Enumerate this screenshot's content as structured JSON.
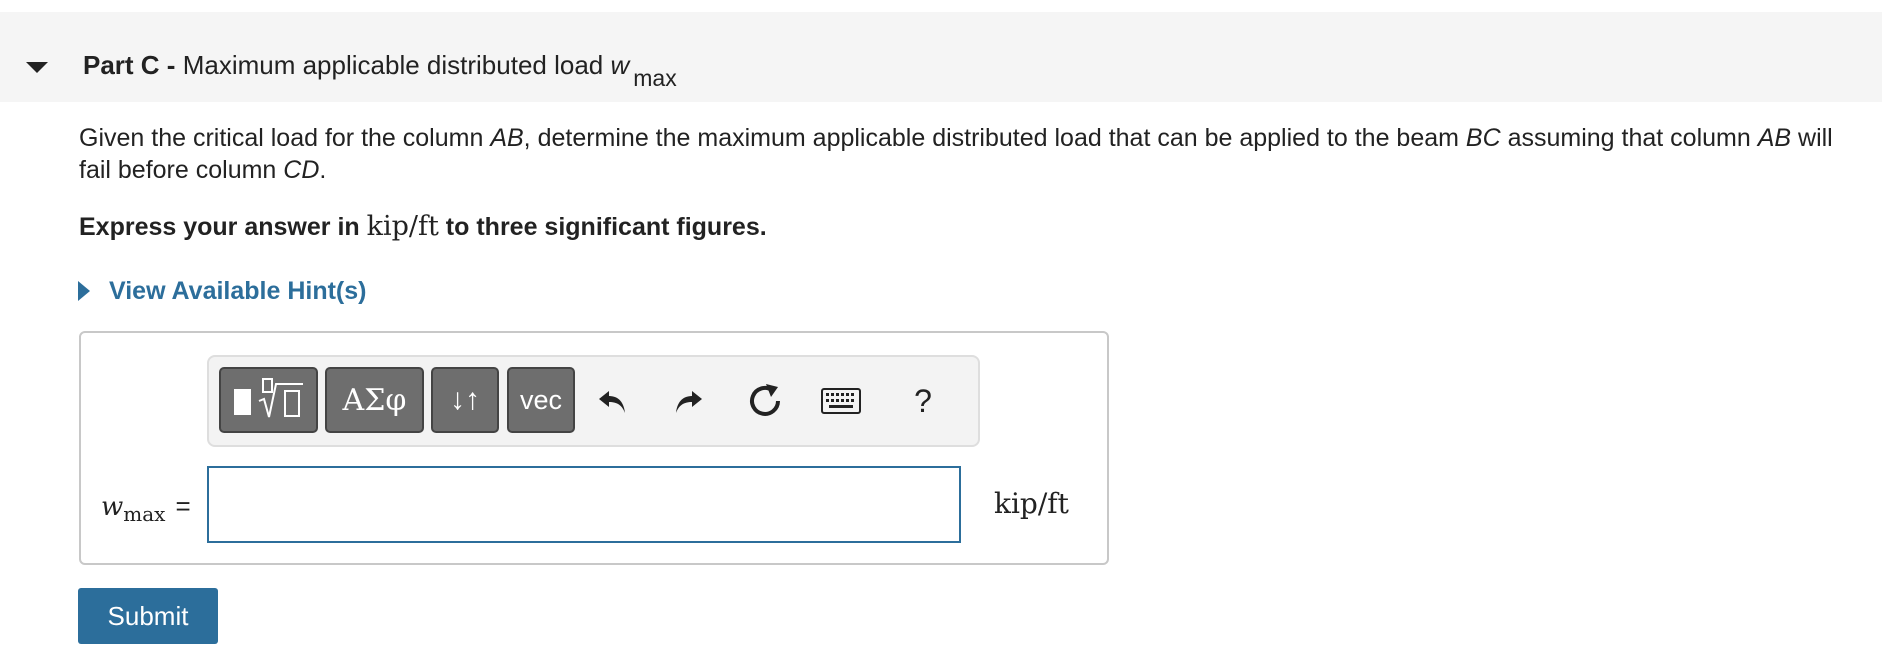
{
  "part": {
    "label": "Part C -",
    "title": "Maximum applicable distributed load",
    "var": "w",
    "sub": "max"
  },
  "question": {
    "t1": "Given the critical load for the column ",
    "AB": "AB",
    "t2": ", determine the maximum applicable distributed load that can be applied to the beam ",
    "BC": "BC",
    "t3": " assuming that column ",
    "AB2": "AB",
    "t4": " will fail before column ",
    "CD": "CD",
    "t5": "."
  },
  "instructions": {
    "pre": "Express your answer in ",
    "unit": "kip/ft",
    "post": " to three significant figures."
  },
  "hint": {
    "label": "View Available Hint(s)"
  },
  "toolbar": {
    "greek_label": "ΑΣφ",
    "arrows_label": "↓↑",
    "vec_label": "vec",
    "help_label": "?",
    "icons": [
      "templates-icon",
      "greek-icon",
      "subscript-icon",
      "vector-icon",
      "undo-icon",
      "redo-icon",
      "reset-icon",
      "keyboard-icon",
      "help-icon"
    ]
  },
  "answer": {
    "var": "w",
    "sub": "max",
    "eq": "=",
    "value": "",
    "unit": "kip/ft"
  },
  "submit": {
    "label": "Submit"
  },
  "colors": {
    "accent": "#2c6e9b",
    "header_bg": "#f5f5f5",
    "button_gray": "#6e6e6e"
  }
}
